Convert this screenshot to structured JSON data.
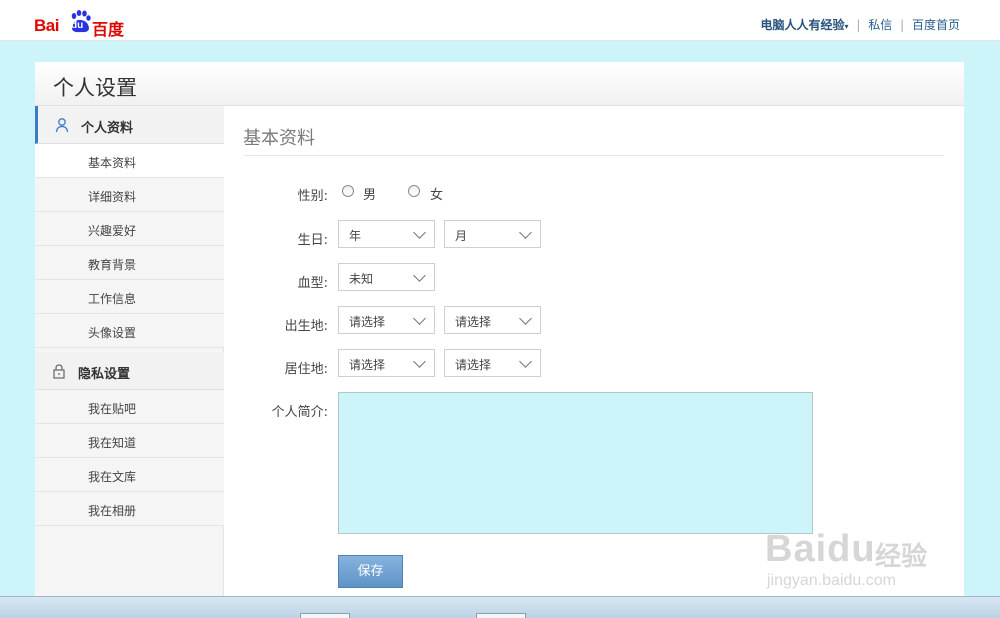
{
  "brand": {
    "bai": "Bai",
    "du": "du",
    "cn": "百度",
    "colors": {
      "red": "#e10601",
      "blue": "#2932e1"
    }
  },
  "topnav": {
    "user": "电脑人人有经验",
    "messages": "私信",
    "homepage": "百度首页",
    "separator": "|",
    "caret": "▾"
  },
  "page": {
    "title": "个人设置"
  },
  "sidebar": {
    "profile_section": {
      "label": "个人资料",
      "icon": "person-icon"
    },
    "profile_items": [
      {
        "label": "基本资料",
        "current": true
      },
      {
        "label": "详细资料"
      },
      {
        "label": "兴趣爱好"
      },
      {
        "label": "教育背景"
      },
      {
        "label": "工作信息"
      },
      {
        "label": "头像设置"
      }
    ],
    "privacy_section": {
      "label": "隐私设置",
      "icon": "lock-icon"
    },
    "privacy_items": [
      {
        "label": "我在贴吧"
      },
      {
        "label": "我在知道"
      },
      {
        "label": "我在文库"
      },
      {
        "label": "我在相册"
      }
    ]
  },
  "form": {
    "title": "基本资料",
    "gender": {
      "label": "性别:",
      "male": "男",
      "female": "女"
    },
    "birthday": {
      "label": "生日:",
      "year": "年",
      "month": "月"
    },
    "blood_type": {
      "label": "血型:",
      "value": "未知"
    },
    "birthplace": {
      "label": "出生地:",
      "province": "请选择",
      "city": "请选择"
    },
    "residence": {
      "label": "居住地:",
      "province": "请选择",
      "city": "请选择"
    },
    "bio": {
      "label": "个人简介:",
      "value": ""
    },
    "save_label": "保存"
  },
  "watermark": {
    "main": "Baidu",
    "cn": "经验",
    "url": "jingyan.baidu.com"
  },
  "colors": {
    "background": "#cdf4f9",
    "accent": "#3a7cc4",
    "button": "#6a9fd0"
  }
}
